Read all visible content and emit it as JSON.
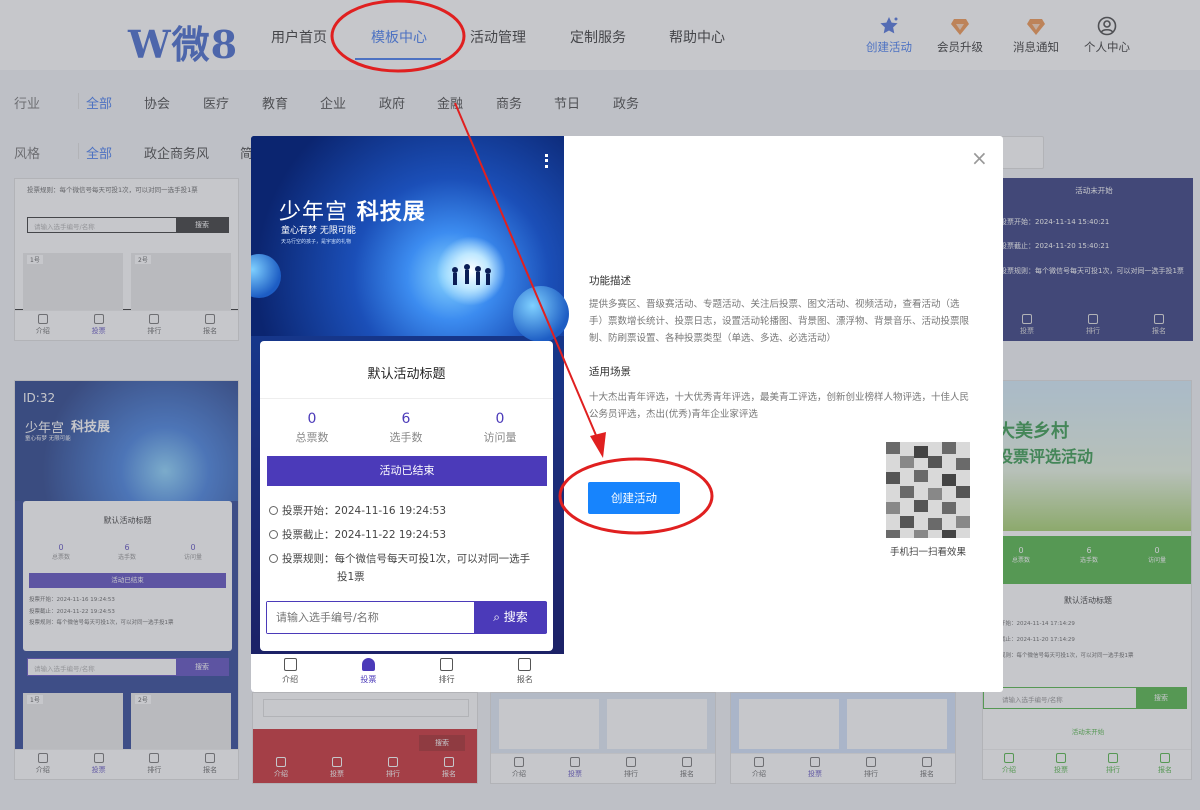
{
  "header": {
    "logo": "W微8",
    "nav": [
      "用户首页",
      "模板中心",
      "活动管理",
      "定制服务",
      "帮助中心"
    ],
    "active_nav": "模板中心",
    "tools": [
      {
        "label": "创建活动",
        "icon": "star-icon"
      },
      {
        "label": "会员升级",
        "icon": "diamond-icon"
      },
      {
        "label": "消息通知",
        "icon": "bell-icon"
      },
      {
        "label": "个人中心",
        "icon": "user-icon"
      }
    ]
  },
  "filters": {
    "industry": {
      "key": "行业",
      "items": [
        "全部",
        "协会",
        "医疗",
        "教育",
        "企业",
        "政府",
        "金融",
        "商务",
        "节日",
        "政务"
      ]
    },
    "style": {
      "key": "风格",
      "items": [
        "全部",
        "政企商务风",
        "简"
      ]
    }
  },
  "bg_cards": {
    "card1": {
      "rule": "投票规则：每个微信号每天可投1次，可以对同一选手投1票",
      "placeholder": "请输入选手编号/名称",
      "search": "搜索",
      "p1": "1号",
      "p2": "2号"
    },
    "card2": {
      "id": "ID:32",
      "title1": "少年宫",
      "title2": "科技展",
      "slogan": "童心有梦 无限可能",
      "name": "默认活动标题",
      "stats": [
        {
          "v": "0",
          "l": "总票数"
        },
        {
          "v": "6",
          "l": "选手数"
        },
        {
          "v": "0",
          "l": "访问量"
        }
      ],
      "ended": "活动已结束",
      "start": "投票开始：2024-11-16 19:24:53",
      "end": "投票截止：2024-11-22 19:24:53",
      "rule": "投票规则：每个微信号每天可投1次，可以对同一选手投1票",
      "placeholder": "请输入选手编号/名称",
      "search": "搜索",
      "p1": "1号",
      "p2": "2号"
    },
    "card3": {
      "status": "活动未开始",
      "start": "投票开始：2024-11-14 15:40:21",
      "end": "投票截止：2024-11-20 15:40:21",
      "rule": "投票规则：每个微信号每天可投1次，可以对同一选手投1票"
    },
    "card4": {
      "title1": "大美乡村",
      "title2": "投票评选活动",
      "stats": [
        {
          "v": "0",
          "l": "总票数"
        },
        {
          "v": "6",
          "l": "选手数"
        },
        {
          "v": "0",
          "l": "访问量"
        }
      ],
      "name": "默认活动标题",
      "start": "投票开始：2024-11-14 17:14:29",
      "end": "投票截止：2024-11-20 17:14:29",
      "rule": "投票规则：每个微信号每天可投1次，可以对同一选手投1票",
      "placeholder": "请输入选手编号/名称",
      "search": "搜索",
      "status": "活动未开始"
    },
    "red_search": "搜索",
    "tabs": [
      "介绍",
      "投票",
      "排行",
      "报名"
    ]
  },
  "preview": {
    "title1": "少年宫",
    "title2": "科技展",
    "slogan": "童心有梦 无限可能",
    "subslogan": "天马行空的孩子，是宇宙的礼物",
    "activity_title": "默认活动标题",
    "stats": [
      {
        "value": "0",
        "label": "总票数"
      },
      {
        "value": "6",
        "label": "选手数"
      },
      {
        "value": "0",
        "label": "访问量"
      }
    ],
    "status_button": "活动已结束",
    "vote_start": "投票开始：2024-11-16 19:24:53",
    "vote_end": "投票截止：2024-11-22 19:24:53",
    "vote_rule_line1": "投票规则：每个微信号每天可投1次，可以对同一选手",
    "vote_rule_line2": "投1票",
    "search_placeholder": "请输入选手编号/名称",
    "search_button": "搜索",
    "tabs": [
      {
        "label": "介绍",
        "icon": "intro-icon"
      },
      {
        "label": "投票",
        "icon": "vote-icon"
      },
      {
        "label": "排行",
        "icon": "ranking-icon"
      },
      {
        "label": "报名",
        "icon": "signup-icon"
      }
    ],
    "active_tab": "投票"
  },
  "detail": {
    "close": "×",
    "feature_heading": "功能描述",
    "feature_text": "提供多赛区、晋级赛活动、专题活动、关注后投票、图文活动、视频活动，查看活动（选手）票数增长统计、投票日志，设置活动轮播图、背景图、漂浮物、背景音乐、活动投票限制、防刷票设置、各种投票类型（单选、多选、必选活动）",
    "scene_heading": "适用场景",
    "scene_text": "十大杰出青年评选，十大优秀青年评选，最美青工评选，创新创业榜样人物评选，十佳人民公务员评选，杰出(优秀)青年企业家评选",
    "create_button": "创建活动",
    "qr_caption": "手机扫一扫看效果"
  },
  "colors": {
    "brand_blue": "#2f6df0",
    "vote_purple": "#4b3ab9",
    "create_blue": "#1784fd",
    "annotation_red": "#e02020"
  }
}
